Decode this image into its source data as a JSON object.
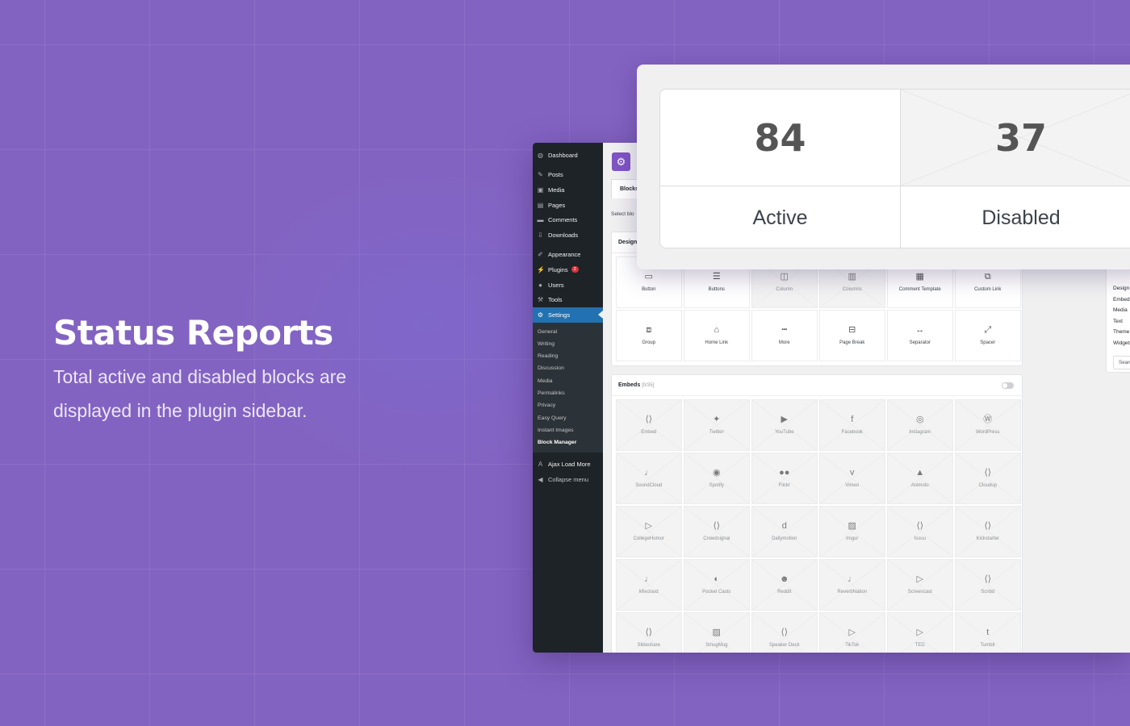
{
  "hero": {
    "title": "Status Reports",
    "description": "Total active and disabled blocks are displayed in the plugin sidebar."
  },
  "stats": {
    "active_count": "84",
    "active_label": "Active",
    "disabled_count": "37",
    "disabled_label": "Disabled"
  },
  "sidebar": {
    "items": [
      {
        "label": "Dashboard",
        "icon": "dashboard-icon"
      },
      {
        "label": "Posts",
        "icon": "pin-icon"
      },
      {
        "label": "Media",
        "icon": "media-icon"
      },
      {
        "label": "Pages",
        "icon": "pages-icon"
      },
      {
        "label": "Comments",
        "icon": "comment-icon"
      },
      {
        "label": "Downloads",
        "icon": "download-icon"
      },
      {
        "label": "Appearance",
        "icon": "brush-icon"
      },
      {
        "label": "Plugins",
        "icon": "plug-icon",
        "badge": "2"
      },
      {
        "label": "Users",
        "icon": "user-icon"
      },
      {
        "label": "Tools",
        "icon": "wrench-icon"
      },
      {
        "label": "Settings",
        "icon": "settings-icon"
      }
    ],
    "submenu": [
      "General",
      "Writing",
      "Reading",
      "Discussion",
      "Media",
      "Permalinks",
      "Privacy",
      "Easy Query",
      "Instant Images",
      "Block Manager"
    ],
    "ajax_load_more": "Ajax Load More",
    "collapse_menu": "Collapse menu"
  },
  "main": {
    "tab_label": "Blocks",
    "select_text": "Select blo",
    "design_panel": {
      "title": "Design",
      "tiles": [
        {
          "label": "Button",
          "icon": "button-icon",
          "disabled": false
        },
        {
          "label": "Buttons",
          "icon": "buttons-icon",
          "disabled": false
        },
        {
          "label": "Column",
          "icon": "column-icon",
          "disabled": true
        },
        {
          "label": "Columns",
          "icon": "columns-icon",
          "disabled": true
        },
        {
          "label": "Comment Template",
          "icon": "template-icon",
          "disabled": false
        },
        {
          "label": "Custom Link",
          "icon": "link-icon",
          "disabled": false
        },
        {
          "label": "Group",
          "icon": "group-icon",
          "disabled": false
        },
        {
          "label": "Home Link",
          "icon": "home-icon",
          "disabled": false
        },
        {
          "label": "More",
          "icon": "more-icon",
          "disabled": false
        },
        {
          "label": "Page Break",
          "icon": "page-break-icon",
          "disabled": false
        },
        {
          "label": "Separator",
          "icon": "separator-icon",
          "disabled": false
        },
        {
          "label": "Spacer",
          "icon": "spacer-icon",
          "disabled": false
        }
      ]
    },
    "embeds_panel": {
      "title": "Embeds",
      "count": "[0/35]",
      "tiles": [
        {
          "label": "Embed",
          "icon": "embed-icon"
        },
        {
          "label": "Twitter",
          "icon": "twitter-icon"
        },
        {
          "label": "YouTube",
          "icon": "youtube-icon"
        },
        {
          "label": "Facebook",
          "icon": "facebook-icon"
        },
        {
          "label": "Instagram",
          "icon": "instagram-icon"
        },
        {
          "label": "WordPress",
          "icon": "wordpress-icon"
        },
        {
          "label": "SoundCloud",
          "icon": "audio-icon"
        },
        {
          "label": "Spotify",
          "icon": "spotify-icon"
        },
        {
          "label": "Flickr",
          "icon": "flickr-icon"
        },
        {
          "label": "Vimeo",
          "icon": "vimeo-icon"
        },
        {
          "label": "Animoto",
          "icon": "animoto-icon"
        },
        {
          "label": "Cloudup",
          "icon": "embed-icon"
        },
        {
          "label": "CollegeHumor",
          "icon": "video-icon"
        },
        {
          "label": "Crowdsignal",
          "icon": "embed-icon"
        },
        {
          "label": "Dailymotion",
          "icon": "dailymotion-icon"
        },
        {
          "label": "Imgur",
          "icon": "image-icon"
        },
        {
          "label": "Issuu",
          "icon": "embed-icon"
        },
        {
          "label": "Kickstarter",
          "icon": "embed-icon"
        },
        {
          "label": "Mixcloud",
          "icon": "audio-icon"
        },
        {
          "label": "Pocket Casts",
          "icon": "pocketcasts-icon"
        },
        {
          "label": "Reddit",
          "icon": "reddit-icon"
        },
        {
          "label": "ReverbNation",
          "icon": "audio-icon"
        },
        {
          "label": "Screencast",
          "icon": "video-icon"
        },
        {
          "label": "Scribd",
          "icon": "embed-icon"
        },
        {
          "label": "Slideshare",
          "icon": "embed-icon"
        },
        {
          "label": "SmugMug",
          "icon": "image-icon"
        },
        {
          "label": "Speaker Deck",
          "icon": "embed-icon"
        },
        {
          "label": "TikTok",
          "icon": "video-icon"
        },
        {
          "label": "TED",
          "icon": "video-icon"
        },
        {
          "label": "Tumblr",
          "icon": "tumblr-icon"
        }
      ]
    },
    "categories": [
      "Design",
      "Embeds",
      "Media",
      "Text",
      "Theme",
      "Widgets"
    ],
    "search_placeholder": "Search Blocks"
  },
  "colors": {
    "background": "#8363c2",
    "wp_sidebar": "#1d2327",
    "wp_active": "#2271b1",
    "plugin_brand": "#7f54c4",
    "badge": "#d63638"
  }
}
